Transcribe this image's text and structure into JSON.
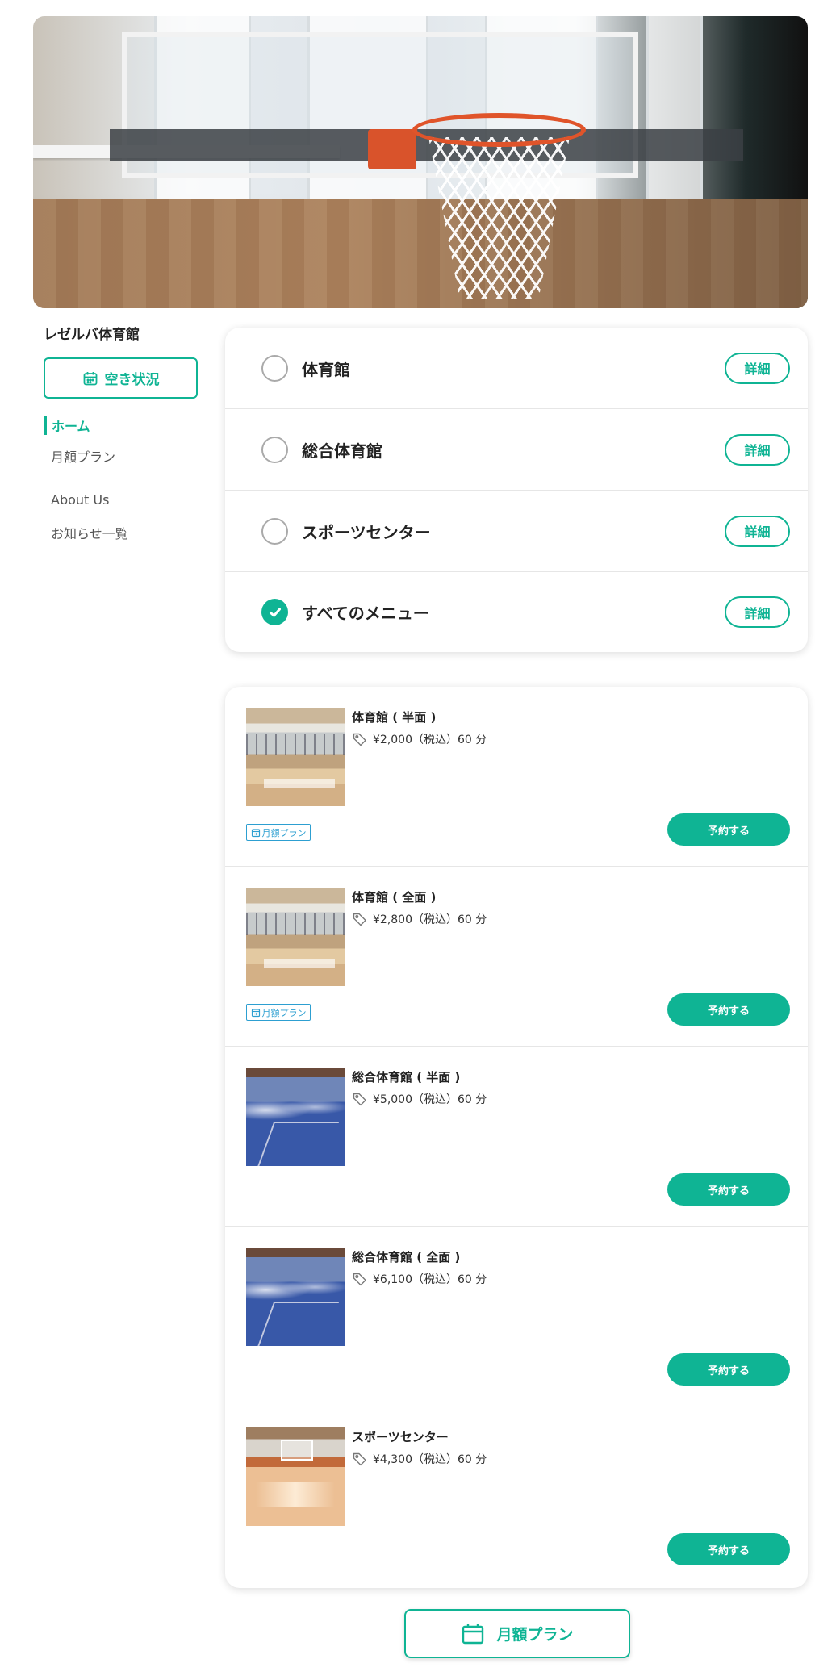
{
  "sidebar": {
    "venue_name": "レゼルバ体育館",
    "availability_button": "空き状況",
    "nav": [
      {
        "label": "ホーム",
        "active": true
      },
      {
        "label": "月額プラン"
      },
      {
        "label": "About Us"
      },
      {
        "label": "お知らせ一覧"
      }
    ]
  },
  "filters": {
    "items": [
      {
        "label": "体育館",
        "checked": false,
        "button": "詳細"
      },
      {
        "label": "総合体育館",
        "checked": false,
        "button": "詳細"
      },
      {
        "label": "スポーツセンター",
        "checked": false,
        "button": "詳細"
      },
      {
        "label": "すべてのメニュー",
        "checked": true,
        "button": "詳細"
      }
    ]
  },
  "plans": [
    {
      "title": "体育館 ( 半面 )",
      "price": "¥2,000（税込）60 分",
      "badge": "月額プラン",
      "button": "予約する"
    },
    {
      "title": "体育館 ( 全面 )",
      "price": "¥2,800（税込）60 分",
      "badge": "月額プラン",
      "button": "予約する"
    },
    {
      "title": "総合体育館 ( 半面 )",
      "price": "¥5,000（税込）60 分",
      "button": "予約する"
    },
    {
      "title": "総合体育館 ( 全面 )",
      "price": "¥6,100（税込）60 分",
      "button": "予約する"
    },
    {
      "title": "スポーツセンター",
      "price": "¥4,300（税込）60 分",
      "button": "予約する"
    }
  ],
  "bottom_button": "月額プラン",
  "colors": {
    "accent": "#0fb494",
    "badge": "#2d9fd1"
  }
}
